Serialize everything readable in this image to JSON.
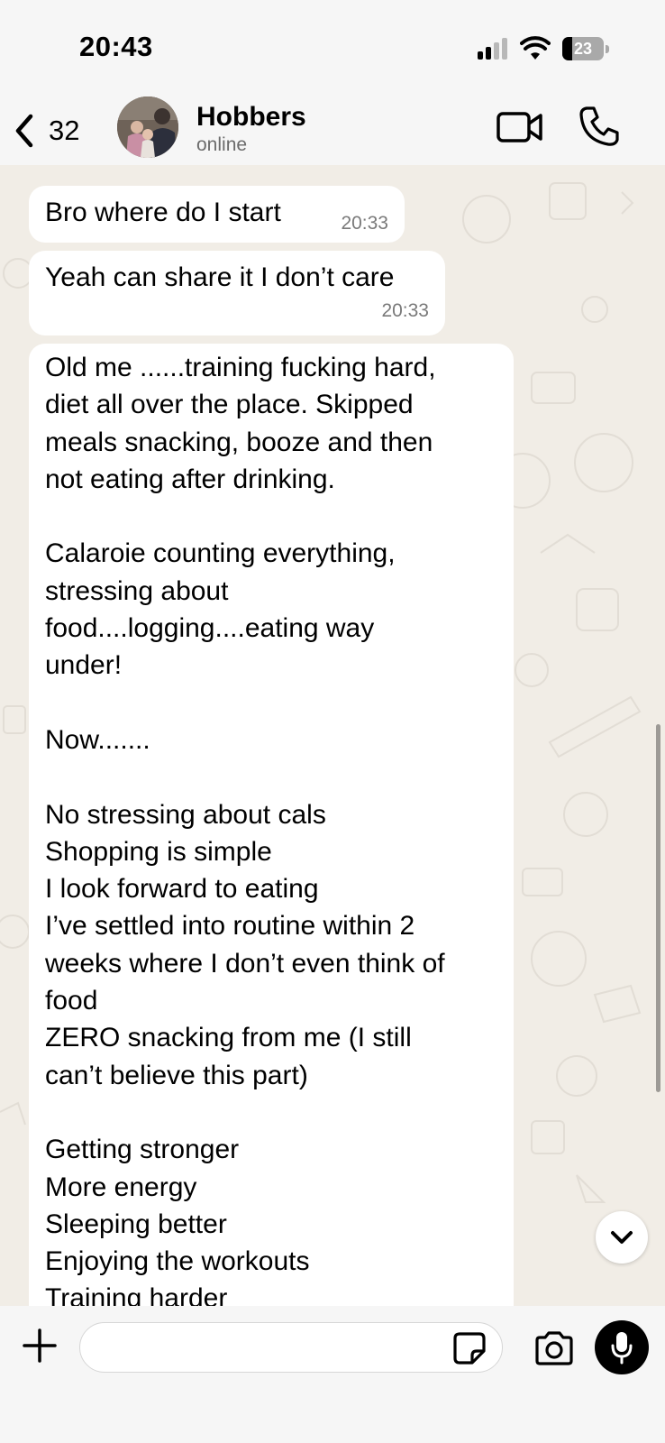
{
  "status_bar": {
    "time": "20:43",
    "battery_level": "23",
    "signal_bars": 2,
    "icons": [
      "signal-icon",
      "wifi-icon",
      "battery-icon"
    ]
  },
  "header": {
    "back_count": "32",
    "contact_name": "Hobbers",
    "contact_status": "online",
    "icons": [
      "chevron-left-icon",
      "avatar",
      "video-call-icon",
      "phone-icon"
    ]
  },
  "messages": [
    {
      "text": "Bro where do I start",
      "time": "20:33"
    },
    {
      "text": "Yeah can share it I don’t care",
      "time": "20:33"
    },
    {
      "text": "Old me ......training fucking hard,\ndiet all over the place. Skipped\nmeals snacking, booze and then\nnot eating after drinking.\n\nCalaroie counting everything,\nstressing about\nfood....logging....eating way\nunder!\n\nNow.......\n\nNo stressing about cals\nShopping is simple\nI look forward to eating\nI’ve settled into routine within 2\nweeks where I don’t even think of\nfood\nZERO snacking from me (I still\ncan’t believe this part)\n\nGetting stronger\nMore energy\nSleeping better\nEnjoying the workouts\nTraining harder",
      "time": ""
    }
  ],
  "input": {
    "placeholder": "",
    "icons": [
      "plus-icon",
      "sticker-icon",
      "camera-icon",
      "microphone-icon",
      "chevron-down-icon"
    ]
  },
  "colors": {
    "wallpaper": "#f1ede6",
    "bubble": "#ffffff",
    "bar": "#f6f6f6",
    "timestamp": "#7a7a7a"
  }
}
